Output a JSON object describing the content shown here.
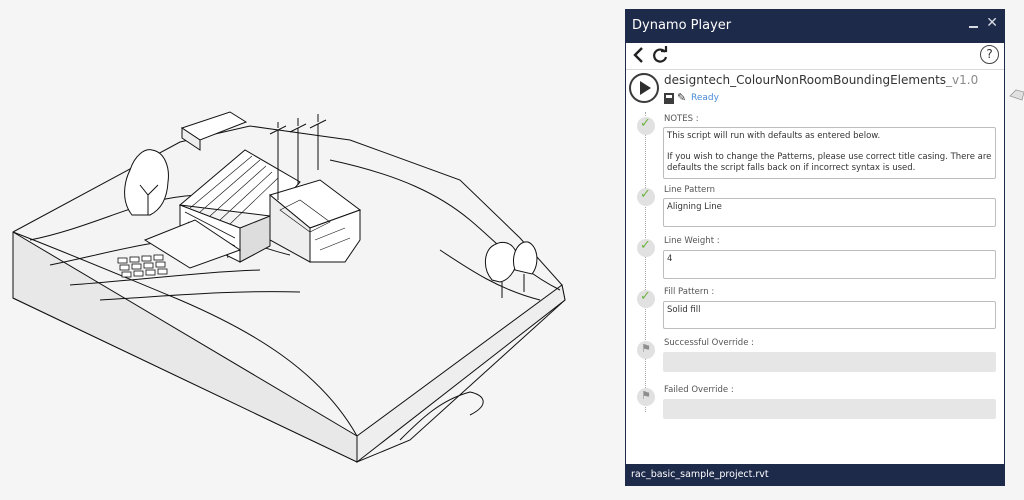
{
  "window": {
    "title": "Dynamo Player"
  },
  "toolbar": {
    "help_label": "?"
  },
  "script": {
    "name": "designtech_ColourNonRoomBoundingElements",
    "version": "_v1.0",
    "status": "Ready"
  },
  "steps": [
    {
      "label": "NOTES :",
      "state": "complete",
      "lines": [
        "This script will run with defaults as entered below.",
        "If you wish to change the Patterns, please use correct title casing. There are defaults the script falls back on if incorrect syntax is used."
      ]
    },
    {
      "label": "Line Pattern",
      "value": "Aligning Line",
      "state": "complete"
    },
    {
      "label": "Line Weight :",
      "value": "4",
      "state": "complete"
    },
    {
      "label": "Fill Pattern :",
      "value": "Solid fill",
      "state": "complete"
    },
    {
      "label": "Successful Override :",
      "value": "",
      "state": "pending"
    },
    {
      "label": "Failed Override :",
      "value": "",
      "state": "pending"
    }
  ],
  "footer": {
    "file": "rac_basic_sample_project.rvt"
  },
  "colors": {
    "titlebar": "#1e2a4a",
    "check": "#6db33f",
    "status": "#4a8bd6"
  }
}
